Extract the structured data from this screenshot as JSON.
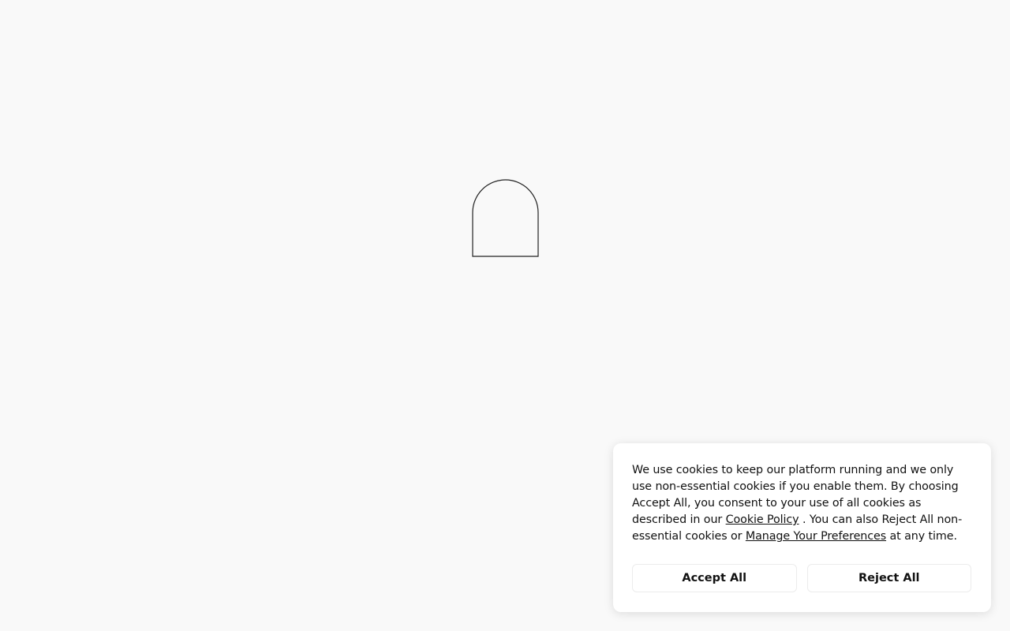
{
  "loader": {
    "icon": "arch-outline-icon"
  },
  "cookie_banner": {
    "text_before_policy": "We use cookies to keep our platform running and we only use non-essential cookies if you enable them. By choosing Accept All, you consent to your use of all cookies as described in our ",
    "cookie_policy_link": "Cookie Policy",
    "text_middle": " . You can also Reject All non-essential cookies or ",
    "manage_preferences_link": "Manage Your Preferences",
    "text_after": " at any time.",
    "accept_label": "Accept All",
    "reject_label": "Reject All"
  }
}
